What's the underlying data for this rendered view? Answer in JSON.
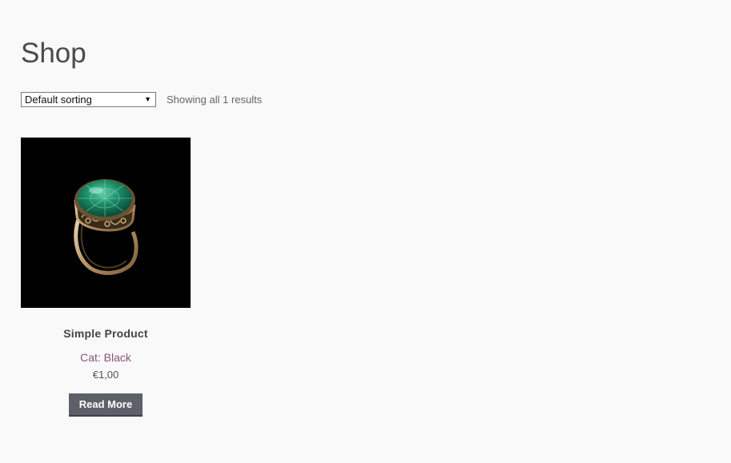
{
  "page": {
    "title": "Shop"
  },
  "toolbar": {
    "sort_selected": "Default sorting",
    "result_count": "Showing all 1 results"
  },
  "products": [
    {
      "name": "Simple Product",
      "category": "Cat: Black",
      "price": "€1,00",
      "button_label": "Read More",
      "image": "emerald-ring"
    }
  ],
  "colors": {
    "background": "#f9f9f9",
    "category_link": "#8a5374",
    "button": "#5d6068",
    "image_background": "#000000"
  }
}
